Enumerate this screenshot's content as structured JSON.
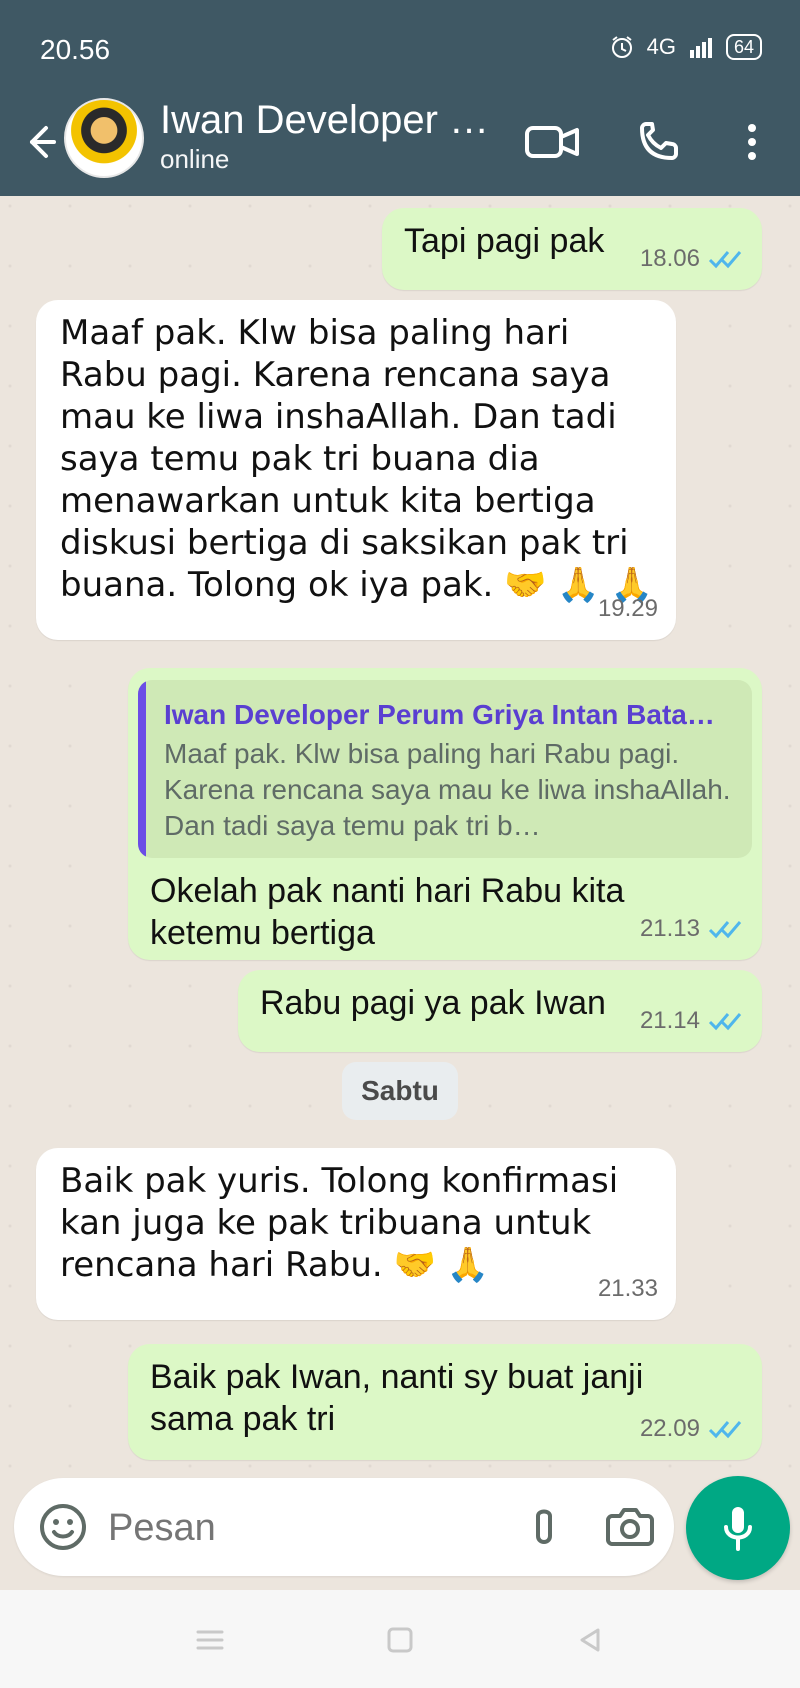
{
  "status_bar": {
    "time": "20.56",
    "network": "4G",
    "battery": "64"
  },
  "header": {
    "title": "Iwan Developer P...",
    "subtitle": "online"
  },
  "messages": [
    {
      "type": "outgoing",
      "text": "Tapi pagi pak",
      "time": "18.06"
    },
    {
      "type": "incoming",
      "text": "Maaf pak. Klw bisa paling hari Rabu pagi. Karena rencana saya mau ke liwa inshaAllah. Dan tadi saya temu pak tri buana dia menawarkan untuk kita bertiga diskusi bertiga di saksikan pak tri buana. Tolong ok iya pak. 🤝 🙏 🙏",
      "time": "19.29"
    },
    {
      "type": "outgoing",
      "quote": {
        "author": "Iwan Developer Perum Griya Intan Bata…",
        "text": "Maaf pak. Klw bisa paling hari Rabu pagi. Karena rencana saya mau ke liwa inshaAllah. Dan tadi saya temu pak tri b…"
      },
      "text": "Okelah pak nanti hari Rabu kita ketemu bertiga",
      "time": "21.13"
    },
    {
      "type": "outgoing",
      "text": "Rabu pagi ya pak Iwan",
      "time": "21.14"
    },
    {
      "type": "incoming",
      "text": "Baik pak yuris. Tolong konfirmasi kan juga ke pak tribuana untuk rencana hari Rabu. 🤝 🙏",
      "time": "21.33"
    },
    {
      "type": "outgoing",
      "text": "Baik pak Iwan, nanti sy buat janji sama pak tri",
      "time": "22.09"
    }
  ],
  "day_chip": "Sabtu",
  "composer": {
    "placeholder": "Pesan"
  },
  "colors": {
    "header": "#3f5864",
    "chat_bg": "#ece5dd",
    "outgoing": "#dcf8c6",
    "incoming": "#ffffff",
    "accent": "#00a884",
    "read_ticks": "#4fb6ec"
  },
  "icons": {
    "back": "back-arrow-icon",
    "video": "video-call-icon",
    "phone": "voice-call-icon",
    "menu": "more-vert-icon",
    "emoji": "emoji-icon",
    "attach": "paperclip-icon",
    "camera": "camera-icon",
    "mic": "mic-icon"
  }
}
